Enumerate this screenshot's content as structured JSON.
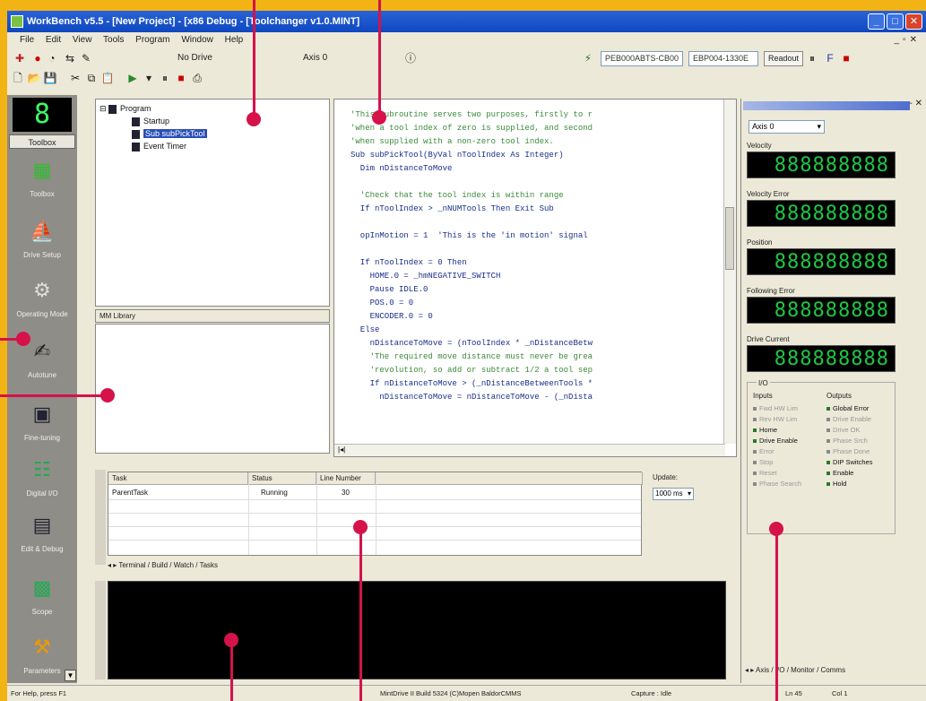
{
  "window": {
    "title": "WorkBench v5.5 - [New Project] - [x86 Debug - [Toolchanger v1.0.MINT]"
  },
  "menu": [
    "File",
    "Edit",
    "View",
    "Tools",
    "Program",
    "Window",
    "Help"
  ],
  "toolbar": {
    "drive_label": "No Drive",
    "axis_label": "Axis 0",
    "conn1": "PEB000ABTS-CB00",
    "conn2": "EBP004-1330E",
    "readout": "Readout"
  },
  "toolbox": {
    "display": "8",
    "title": "Toolbox",
    "tools": [
      "Toolbox",
      "Drive Setup",
      "Operating Mode",
      "Autotune",
      "Fine-tuning",
      "Digital I/O",
      "Edit & Debug",
      "Scope",
      "Parameters"
    ]
  },
  "tree": {
    "root": "Program",
    "items": [
      "Startup",
      "Sub subPickTool",
      "Event Timer"
    ],
    "selected_index": 1
  },
  "mm_library": "MM Library",
  "code": [
    {
      "t": "'This subroutine serves two purposes, firstly to r",
      "c": true
    },
    {
      "t": "'when a tool index of zero is supplied, and second",
      "c": true
    },
    {
      "t": "'when supplied with a non-zero tool index.",
      "c": true
    },
    {
      "t": "Sub subPickTool(ByVal nToolIndex As Integer)",
      "c": false
    },
    {
      "t": "  Dim nDistanceToMove",
      "c": false
    },
    {
      "t": "",
      "c": false
    },
    {
      "t": "  'Check that the tool index is within range",
      "c": true
    },
    {
      "t": "  If nToolIndex > _nNUMTools Then Exit Sub",
      "c": false
    },
    {
      "t": "",
      "c": false
    },
    {
      "t": "  opInMotion = 1  'This is the 'in motion' signal",
      "c": false
    },
    {
      "t": "",
      "c": false
    },
    {
      "t": "  If nToolIndex = 0 Then",
      "c": false
    },
    {
      "t": "    HOME.0 = _hmNEGATIVE_SWITCH",
      "c": false
    },
    {
      "t": "    Pause IDLE.0",
      "c": false
    },
    {
      "t": "    POS.0 = 0",
      "c": false
    },
    {
      "t": "    ENCODER.0 = 0",
      "c": false
    },
    {
      "t": "  Else",
      "c": false
    },
    {
      "t": "    nDistanceToMove = (nToolIndex * _nDistanceBetw",
      "c": false
    },
    {
      "t": "    'The required move distance must never be grea",
      "c": true
    },
    {
      "t": "    'revolution, so add or subtract 1/2 a tool sep",
      "c": true
    },
    {
      "t": "    If nDistanceToMove > (_nDistanceBetweenTools *",
      "c": false
    },
    {
      "t": "      nDistanceToMove = nDistanceToMove - (_nDista",
      "c": false
    }
  ],
  "monitor": {
    "axis_select": "Axis 0",
    "channels": [
      {
        "label": "Velocity",
        "value": "888888888"
      },
      {
        "label": "Velocity Error",
        "value": "888888888"
      },
      {
        "label": "Position",
        "value": "888888888"
      },
      {
        "label": "Following Error",
        "value": "888888888"
      },
      {
        "label": "Drive Current",
        "value": "888888888"
      }
    ],
    "io_title": "I/O",
    "inputs_title": "Inputs",
    "outputs_title": "Outputs",
    "inputs": [
      {
        "label": "Fwd HW Lim",
        "on": false
      },
      {
        "label": "Rev HW Lim",
        "on": false
      },
      {
        "label": "Home",
        "on": true
      },
      {
        "label": "Drive Enable",
        "on": true
      },
      {
        "label": "Error",
        "on": false
      },
      {
        "label": "Stop",
        "on": false
      },
      {
        "label": "Reset",
        "on": false
      },
      {
        "label": "Phase Search",
        "on": false
      }
    ],
    "outputs": [
      {
        "label": "Global Error",
        "on": true
      },
      {
        "label": "Drive Enable",
        "on": false
      },
      {
        "label": "Drive OK",
        "on": false
      },
      {
        "label": "Phase Srch",
        "on": false
      },
      {
        "label": "Phase Done",
        "on": false
      },
      {
        "label": "DIP Switches",
        "on": true
      },
      {
        "label": "Enable",
        "on": true
      },
      {
        "label": "Hold",
        "on": true
      }
    ],
    "tabs": "Axis / I/O / Monitor / Comms"
  },
  "tasks": {
    "headers": [
      "Task",
      "Status",
      "Line Number"
    ],
    "rows": [
      {
        "task": "ParentTask",
        "status": "Running",
        "line": "30"
      }
    ],
    "update_label": "Update:",
    "update_value": "1000 ms",
    "tabs": "Terminal / Build / Watch / Tasks"
  },
  "status": {
    "help": "For Help, press F1",
    "build": "MintDrive II Build 5324 (C)Mopen BaldorCMMS",
    "capture": "Capture : Idle",
    "line": "Ln 45",
    "col": "Col 1"
  }
}
